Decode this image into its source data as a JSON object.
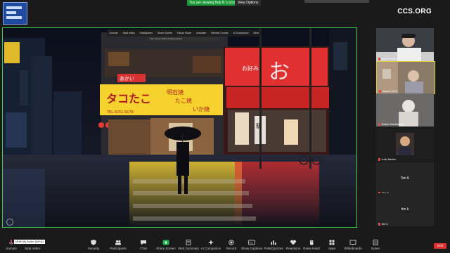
{
  "top_bar": {
    "viewing_banner": "You are viewing Bob B.'s screen",
    "view_options": "View Options",
    "brand": "CCS.ORG"
  },
  "shared_screen": {
    "inner_toolbar": [
      "Unmute",
      "Start Video",
      "Participants",
      "Share Screen",
      "Pause Share",
      "Annotate",
      "Remote Control",
      "AI Companion",
      "More"
    ],
    "inner_notice": "Your screen share is being viewed",
    "sign_texts": {
      "yellow_main": "タコたこ",
      "yellow_right": "明石焼",
      "yellow_right2": "たこ焼",
      "yellow_right3": "いか焼",
      "phone": "TEL.6251-6178",
      "red_main": "お好み",
      "small_red": "あかい",
      "vertical": "駅前屋"
    }
  },
  "participants": [
    {
      "name": "Bob Proctor",
      "type": "video",
      "active": false
    },
    {
      "name": "Zippm CCS",
      "type": "video",
      "active": true
    },
    {
      "name": "Baker Mackleager",
      "type": "video",
      "active": false
    },
    {
      "name": "Irvik Baxter",
      "type": "video",
      "active": false
    },
    {
      "name": "Tim K",
      "type": "name",
      "label": "Tim K",
      "active": false
    },
    {
      "name": "tim k",
      "type": "name",
      "label": "tim k",
      "active": false
    }
  ],
  "toolbar": {
    "tooltip": "Mute My Audio (Alt+A)",
    "items": [
      {
        "label": "Unmute",
        "icon": "mic-icon"
      },
      {
        "label": "Stop Video",
        "icon": "video-icon"
      },
      {
        "label": "Security",
        "icon": "shield-icon"
      },
      {
        "label": "Participants",
        "icon": "people-icon"
      },
      {
        "label": "Chat",
        "icon": "chat-icon"
      },
      {
        "label": "Share Screen",
        "icon": "share-icon"
      },
      {
        "label": "Start Summary",
        "icon": "summary-icon"
      },
      {
        "label": "AI Companion",
        "icon": "sparkle-icon"
      },
      {
        "label": "Record",
        "icon": "record-icon"
      },
      {
        "label": "Show Captions",
        "icon": "cc-icon"
      },
      {
        "label": "Polls/Quizzes",
        "icon": "poll-icon"
      },
      {
        "label": "Reactions",
        "icon": "heart-icon"
      },
      {
        "label": "Raise Hand",
        "icon": "hand-icon"
      },
      {
        "label": "Apps",
        "icon": "apps-icon"
      },
      {
        "label": "Whiteboards",
        "icon": "whiteboard-icon"
      },
      {
        "label": "Notes",
        "icon": "notes-icon"
      }
    ],
    "end_label": "End"
  },
  "colors": {
    "accent_green": "#3ad14a",
    "active_yellow": "#e3cf3d",
    "end_red": "#e02f2f"
  }
}
